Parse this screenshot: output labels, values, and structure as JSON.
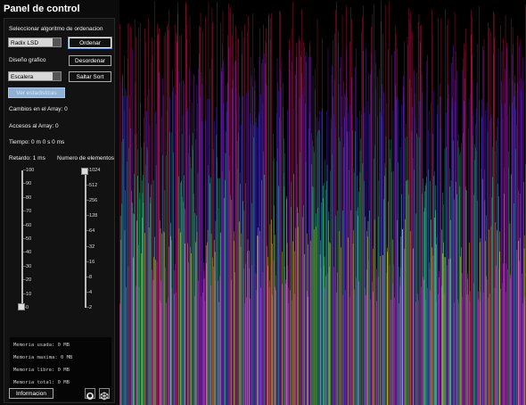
{
  "panel": {
    "title": "Panel de control",
    "algo_label": "Seleccionar algoritmo de ordenacion",
    "algo_value": "Radix LSD",
    "sort_button": "Ordenar",
    "design_label": "Diseño grafico",
    "shuffle_button": "Desordenar",
    "design_value": "Escalera",
    "skip_button": "Saltar Sort",
    "disabled_button": "Ver estadisticas",
    "stats": {
      "changes": "Cambios en el Array: 0",
      "accesses": "Accesos al Array: 0",
      "time": "Tiempo: 0 m 0 s 0 ms"
    },
    "delay_label": "Retardo: 1 ms",
    "elements_label": "Numero de elementos",
    "delay_ticks": [
      "100",
      "90",
      "80",
      "70",
      "60",
      "50",
      "40",
      "30",
      "20",
      "10",
      "0"
    ],
    "delay_value": 1,
    "element_ticks": [
      "1024",
      "512",
      "256",
      "128",
      "64",
      "32",
      "16",
      "8",
      "4",
      "2"
    ],
    "element_value": "1024",
    "memory": {
      "used": "Memoria usada: 0 MB",
      "max": "Memoria maxima: 0 MB",
      "free": "Memoria libre: 0 MB",
      "total": "Memoria total: 0 MB"
    },
    "info_button": "Informacion"
  },
  "visualization": {
    "bar_count": 1024,
    "colors": [
      "#c8104a",
      "#7a1cc0",
      "#3a2ee0",
      "#1e8a5a",
      "#2fd08a",
      "#e0e020",
      "#d03ad0"
    ]
  }
}
